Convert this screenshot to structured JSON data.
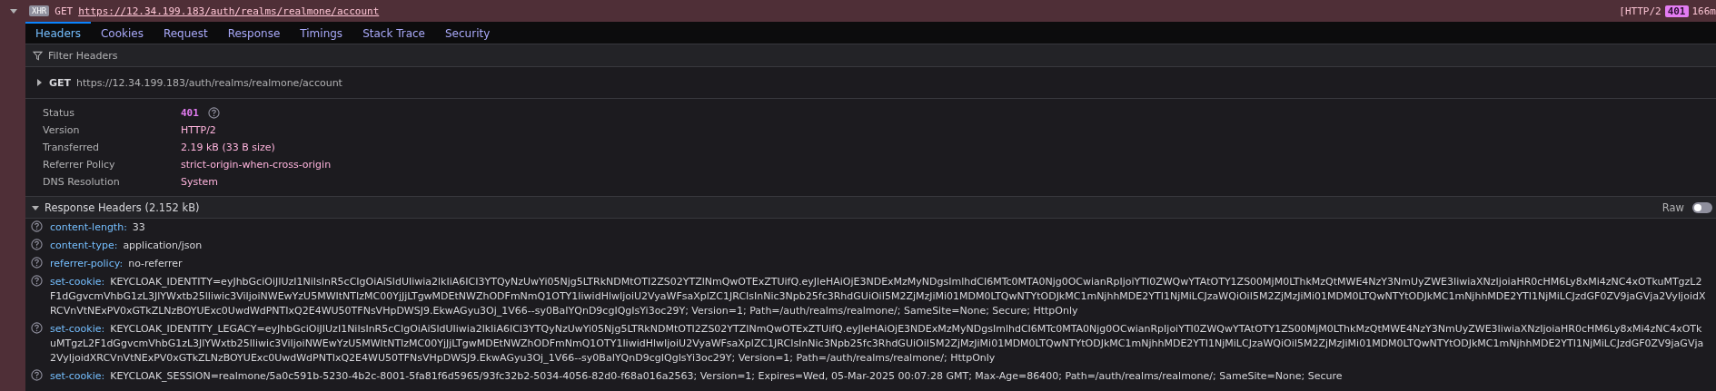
{
  "request_bar": {
    "expanded": true,
    "type_badge": "XHR",
    "method": "GET",
    "url": "https://12.34.199.183/auth/realms/realmone/account",
    "protocol": "[HTTP/2",
    "status": "401",
    "duration": "166m"
  },
  "tabs": [
    {
      "label": "Headers",
      "selected": true
    },
    {
      "label": "Cookies",
      "selected": false
    },
    {
      "label": "Request",
      "selected": false
    },
    {
      "label": "Response",
      "selected": false
    },
    {
      "label": "Timings",
      "selected": false
    },
    {
      "label": "Stack Trace",
      "selected": false
    },
    {
      "label": "Security",
      "selected": false
    }
  ],
  "filter": {
    "placeholder": "Filter Headers"
  },
  "request_line": {
    "expanded": false,
    "method": "GET",
    "url": "https://12.34.199.183/auth/realms/realmone/account"
  },
  "summary": [
    {
      "kind": "status",
      "label": "Status",
      "value": "401"
    },
    {
      "kind": "text",
      "label": "Version",
      "value": "HTTP/2"
    },
    {
      "kind": "text",
      "label": "Transferred",
      "value": "2.19 kB (33 B size)"
    },
    {
      "kind": "text",
      "label": "Referrer Policy",
      "value": "strict-origin-when-cross-origin"
    },
    {
      "kind": "text",
      "label": "DNS Resolution",
      "value": "System"
    }
  ],
  "response_headers": {
    "title": "Response Headers (2.152 kB)",
    "expanded": true,
    "raw_label": "Raw",
    "raw_on": false,
    "headers": [
      {
        "name": "content-length:",
        "value": "33"
      },
      {
        "name": "content-type:",
        "value": "application/json"
      },
      {
        "name": "referrer-policy:",
        "value": "no-referrer"
      },
      {
        "name": "set-cookie:",
        "value": "KEYCLOAK_IDENTITY=eyJhbGciOiJIUzI1NiIsInR5cCIgOiAiSldUIiwia2lkIiA6ICI3YTQyNzUwYi05Njg5LTRkNDMtOTI2ZS02YTZlNmQwOTExZTUifQ.eyJleHAiOjE3NDExMzMyNDgsImlhdCI6MTc0MTA0Njg0OCwianRpIjoiYTI0ZWQwYTAtOTY1ZS00MjM0LThkMzQtMWE4NzY3NmUyZWE3IiwiaXNzIjoiaHR0cHM6Ly8xMi4zNC4xOTkuMTgzL2F1dGgvcmVhbG1zL3JlYWxtb25lIiwic3ViIjoiNWEwYzU5MWItNTIzMC00YjJjLTgwMDEtNWZhODFmNmQ1OTY1IiwidHlwIjoiU2VyaWFsaXplZC1JRCIsInNic3Npb25fc3RhdGUiOiI5M2ZjMzJiMi01MDM0LTQwNTYtODJkMC1mNjhhMDE2YTI1NjMiLCJzaWQiOiI5M2ZjMzJiMi01MDM0LTQwNTYtODJkMC1mNjhhMDE2YTI1NjMiLCJzdGF0ZV9jaGVja2VyIjoidXRCVnVtNExPV0xGTkZLNzBOYUExc0UwdWdPNTIxQ2E4WU50TFNsVHpDWSJ9.EkwAGyu3Oj_1V66--sy0BaIYQnD9cgIQgIsYi3oc29Y; Version=1; Path=/auth/realms/realmone/; SameSite=None; Secure; HttpOnly"
      },
      {
        "name": "set-cookie:",
        "value": "KEYCLOAK_IDENTITY_LEGACY=eyJhbGciOiJIUzI1NiIsInR5cCIgOiAiSldUIiwia2lkIiA6ICI3YTQyNzUwYi05Njg5LTRkNDMtOTI2ZS02YTZlNmQwOTExZTUifQ.eyJleHAiOjE3NDExMzMyNDgsImlhdCI6MTc0MTA0Njg0OCwianRpIjoiYTI0ZWQwYTAtOTY1ZS00MjM0LThkMzQtMWE4NzY3NmUyZWE3IiwiaXNzIjoiaHR0cHM6Ly8xMi4zNC4xOTkuMTgzL2F1dGgvcmVhbG1zL3JlYWxtb25lIiwic3ViIjoiNWEwYzU5MWItNTIzMC00YjJjLTgwMDEtNWZhODFmNmQ1OTY1IiwidHlwIjoiU2VyaWFsaXplZC1JRCIsInNic3Npb25fc3RhdGUiOiI5M2ZjMzJiMi01MDM0LTQwNTYtODJkMC1mNjhhMDE2YTI1NjMiLCJzaWQiOiI5M2ZjMzJiMi01MDM0LTQwNTYtODJkMC1mNjhhMDE2YTI1NjMiLCJzdGF0ZV9jaGVja2VyIjoidXRCVnVtNExPV0xGTkZLNzBOYUExc0UwdWdPNTIxQ2E4WU50TFNsVHpDWSJ9.EkwAGyu3Oj_1V66--sy0BaIYQnD9cgIQgIsYi3oc29Y; Version=1; Path=/auth/realms/realmone/; HttpOnly"
      },
      {
        "name": "set-cookie:",
        "value": "KEYCLOAK_SESSION=realmone/5a0c591b-5230-4b2c-8001-5fa81f6d5965/93fc32b2-5034-4056-82d0-f68a016a2563; Version=1; Expires=Wed, 05-Mar-2025 00:07:28 GMT; Max-Age=86400; Path=/auth/realms/realmone/; SameSite=None; Secure"
      }
    ]
  }
}
